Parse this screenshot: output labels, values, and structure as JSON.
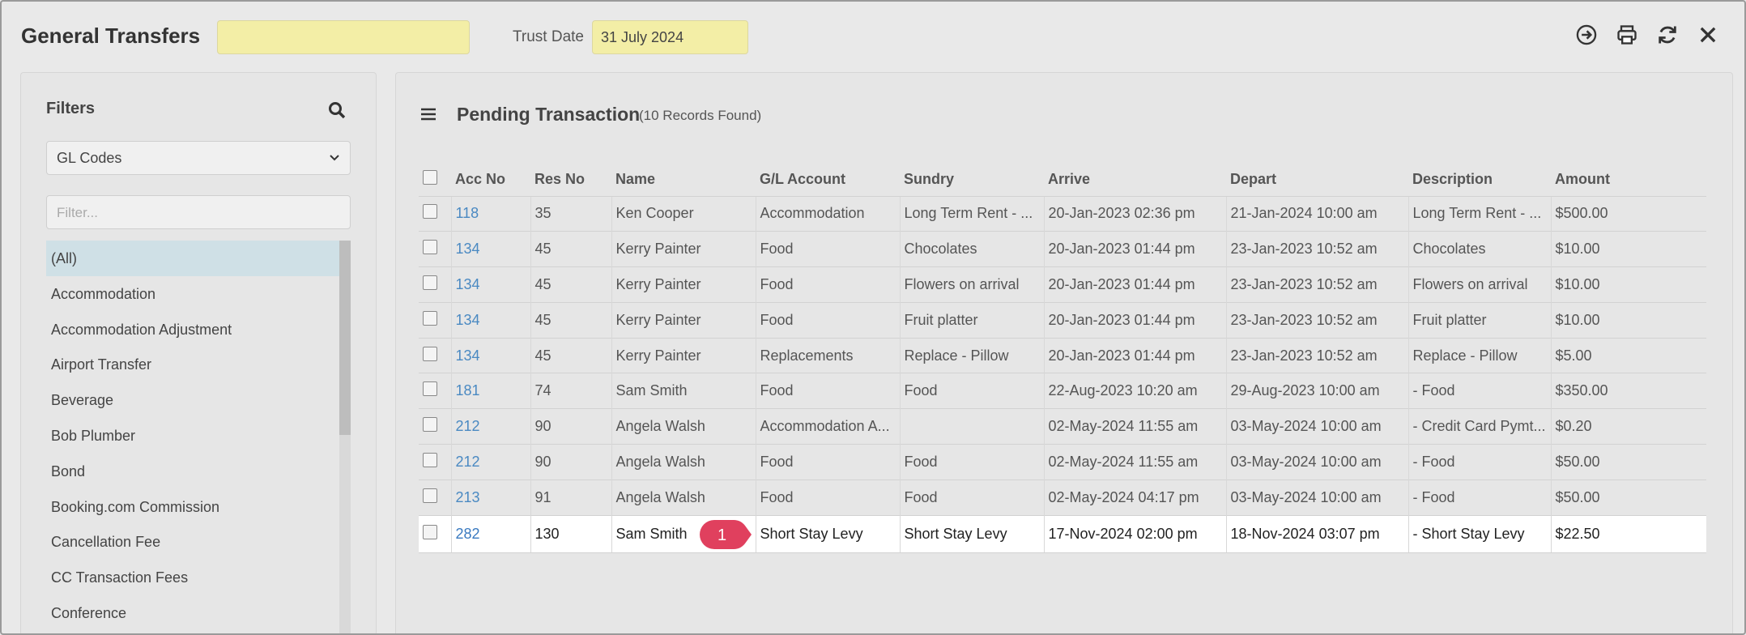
{
  "header": {
    "app_title": "General Transfers",
    "search_value": "",
    "trust_date_label": "Trust Date",
    "trust_date_value": "31 July 2024",
    "icons": [
      "export-icon",
      "print-icon",
      "refresh-icon",
      "close-icon"
    ]
  },
  "filters": {
    "title": "Filters",
    "select_value": "GL Codes",
    "filter_placeholder": "Filter...",
    "items": [
      {
        "label": "(All)"
      },
      {
        "label": "Accommodation"
      },
      {
        "label": "Accommodation Adjustment"
      },
      {
        "label": "Airport Transfer"
      },
      {
        "label": "Beverage"
      },
      {
        "label": "Bob Plumber"
      },
      {
        "label": "Bond"
      },
      {
        "label": "Booking.com Commission"
      },
      {
        "label": "Cancellation Fee"
      },
      {
        "label": "CC Transaction Fees"
      },
      {
        "label": "Conference"
      }
    ]
  },
  "main": {
    "title": "Pending Transaction",
    "records": "(10 Records Found)",
    "columns": [
      "Acc No",
      "Res No",
      "Name",
      "G/L Account",
      "Sundry",
      "Arrive",
      "Depart",
      "Description",
      "Amount"
    ],
    "rows": [
      {
        "acc": "118",
        "res": "35",
        "name": "Ken Cooper",
        "gl": "Accommodation",
        "sundry": "Long Term Rent - ...",
        "arrive": "20-Jan-2023 02:36 pm",
        "depart": "21-Jan-2024 10:00 am",
        "desc": "Long Term Rent - ...",
        "amount": "$500.00"
      },
      {
        "acc": "134",
        "res": "45",
        "name": "Kerry Painter",
        "gl": "Food",
        "sundry": "Chocolates",
        "arrive": "20-Jan-2023 01:44 pm",
        "depart": "23-Jan-2023 10:52 am",
        "desc": "Chocolates",
        "amount": "$10.00"
      },
      {
        "acc": "134",
        "res": "45",
        "name": "Kerry Painter",
        "gl": "Food",
        "sundry": "Flowers on arrival",
        "arrive": "20-Jan-2023 01:44 pm",
        "depart": "23-Jan-2023 10:52 am",
        "desc": "Flowers on arrival",
        "amount": "$10.00"
      },
      {
        "acc": "134",
        "res": "45",
        "name": "Kerry Painter",
        "gl": "Food",
        "sundry": "Fruit platter",
        "arrive": "20-Jan-2023 01:44 pm",
        "depart": "23-Jan-2023 10:52 am",
        "desc": "Fruit platter",
        "amount": "$10.00"
      },
      {
        "acc": "134",
        "res": "45",
        "name": "Kerry Painter",
        "gl": "Replacements",
        "sundry": "Replace - Pillow",
        "arrive": "20-Jan-2023 01:44 pm",
        "depart": "23-Jan-2023 10:52 am",
        "desc": "Replace - Pillow",
        "amount": "$5.00"
      },
      {
        "acc": "181",
        "res": "74",
        "name": "Sam Smith",
        "gl": "Food",
        "sundry": "Food",
        "arrive": "22-Aug-2023 10:20 am",
        "depart": "29-Aug-2023 10:00 am",
        "desc": "- Food",
        "amount": "$350.00"
      },
      {
        "acc": "212",
        "res": "90",
        "name": "Angela Walsh",
        "gl": "Accommodation A...",
        "sundry": "",
        "arrive": "02-May-2024 11:55 am",
        "depart": "03-May-2024 10:00 am",
        "desc": "- Credit Card Pymt...",
        "amount": "$0.20"
      },
      {
        "acc": "212",
        "res": "90",
        "name": "Angela Walsh",
        "gl": "Food",
        "sundry": "Food",
        "arrive": "02-May-2024 11:55 am",
        "depart": "03-May-2024 10:00 am",
        "desc": "- Food",
        "amount": "$50.00"
      },
      {
        "acc": "213",
        "res": "91",
        "name": "Angela Walsh",
        "gl": "Food",
        "sundry": "Food",
        "arrive": "02-May-2024 04:17 pm",
        "depart": "03-May-2024 10:00 am",
        "desc": "- Food",
        "amount": "$50.00"
      },
      {
        "acc": "282",
        "res": "130",
        "name": "Sam Smith",
        "gl": "Short Stay Levy",
        "sundry": "Short Stay Levy",
        "arrive": "17-Nov-2024 02:00 pm",
        "depart": "18-Nov-2024 03:07 pm",
        "desc": "- Short Stay Levy",
        "amount": "$22.50"
      }
    ],
    "highlight_row": 9,
    "callout_label": "1",
    "callout_color": "#e0405e"
  }
}
